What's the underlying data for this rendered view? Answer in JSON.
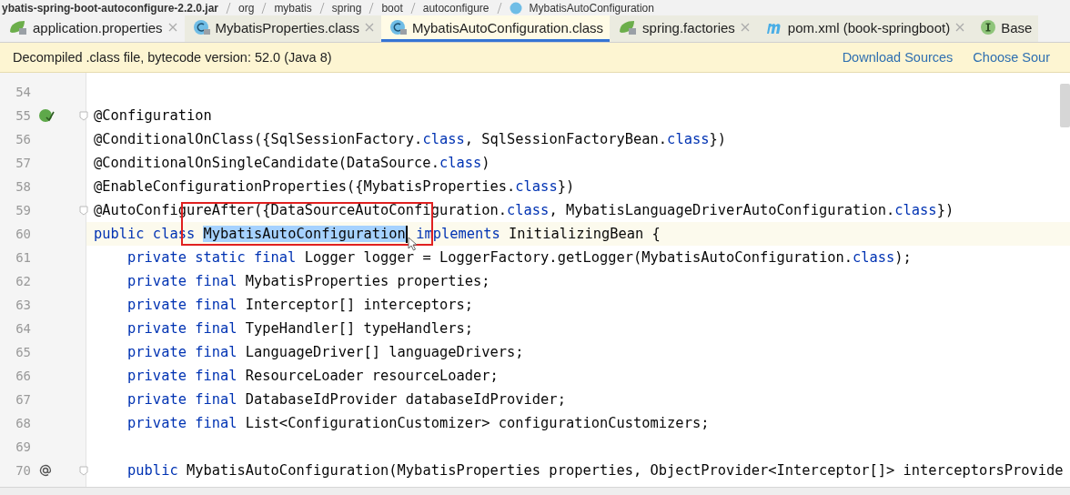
{
  "breadcrumb": [
    {
      "label": "ybatis-spring-boot-autoconfigure-2.2.0.jar",
      "kind": "jar"
    },
    {
      "label": "org",
      "kind": "folder"
    },
    {
      "label": "mybatis",
      "kind": "folder"
    },
    {
      "label": "spring",
      "kind": "folder"
    },
    {
      "label": "boot",
      "kind": "folder"
    },
    {
      "label": "autoconfigure",
      "kind": "folder"
    },
    {
      "label": "MybatisAutoConfiguration",
      "kind": "class"
    }
  ],
  "tabs": [
    {
      "label": "application.properties",
      "kind": "spring",
      "selected": false,
      "closable": true
    },
    {
      "label": "MybatisProperties.class",
      "kind": "class",
      "selected": false,
      "closable": true
    },
    {
      "label": "MybatisAutoConfiguration.class",
      "kind": "class",
      "selected": true,
      "closable": false
    },
    {
      "label": "spring.factories",
      "kind": "spring",
      "selected": false,
      "closable": true
    },
    {
      "label": "pom.xml (book-springboot)",
      "kind": "maven",
      "selected": false,
      "closable": true
    },
    {
      "label": "Base",
      "kind": "interface",
      "selected": false,
      "closable": false
    }
  ],
  "banner": {
    "message": "Decompiled .class file, bytecode version: 52.0 (Java 8)",
    "links": [
      "Download Sources",
      "Choose Sour"
    ]
  },
  "lines": [
    {
      "number": "54"
    },
    {
      "number": "55",
      "kind": "bean",
      "fold": true,
      "tokens": [
        {
          "text": "@Configuration",
          "kind": "plain"
        }
      ]
    },
    {
      "number": "56",
      "tokens": [
        {
          "text": "@ConditionalOnClass({SqlSessionFactory.",
          "kind": "plain"
        },
        {
          "text": "class",
          "kind": "kw"
        },
        {
          "text": ", SqlSessionFactoryBean.",
          "kind": "plain"
        },
        {
          "text": "class",
          "kind": "kw"
        },
        {
          "text": "})",
          "kind": "plain"
        }
      ]
    },
    {
      "number": "57",
      "tokens": [
        {
          "text": "@ConditionalOnSingleCandidate(DataSource.",
          "kind": "plain"
        },
        {
          "text": "class",
          "kind": "kw"
        },
        {
          "text": ")",
          "kind": "plain"
        }
      ]
    },
    {
      "number": "58",
      "tokens": [
        {
          "text": "@EnableConfigurationProperties({MybatisProperties.",
          "kind": "plain"
        },
        {
          "text": "class",
          "kind": "kw"
        },
        {
          "text": "})",
          "kind": "plain"
        }
      ]
    },
    {
      "number": "59",
      "fold": true,
      "tokens": [
        {
          "text": "@AutoConfigureAfter({DataSourceAutoConfiguration.",
          "kind": "plain"
        },
        {
          "text": "class",
          "kind": "kw"
        },
        {
          "text": ", MybatisLanguageDriverAutoConfiguration.",
          "kind": "plain"
        },
        {
          "text": "class",
          "kind": "kw"
        },
        {
          "text": "})",
          "kind": "plain"
        }
      ]
    },
    {
      "number": "60",
      "current": true,
      "tokens": [
        {
          "text": "public class ",
          "kind": "kw"
        },
        {
          "text": "MybatisAutoConfiguration",
          "kind": "selected"
        },
        {
          "text": " implements ",
          "kind": "kw"
        },
        {
          "text": "InitializingBean {",
          "kind": "plain"
        }
      ]
    },
    {
      "number": "61",
      "tokens": [
        {
          "text": "    private static final ",
          "kind": "kw"
        },
        {
          "text": "Logger logger = LoggerFactory.getLogger(MybatisAutoConfiguration.",
          "kind": "plain"
        },
        {
          "text": "class",
          "kind": "kw"
        },
        {
          "text": ");",
          "kind": "plain"
        }
      ]
    },
    {
      "number": "62",
      "tokens": [
        {
          "text": "    private final ",
          "kind": "kw"
        },
        {
          "text": "MybatisProperties properties;",
          "kind": "plain"
        }
      ]
    },
    {
      "number": "63",
      "tokens": [
        {
          "text": "    private final ",
          "kind": "kw"
        },
        {
          "text": "Interceptor[] interceptors;",
          "kind": "plain"
        }
      ]
    },
    {
      "number": "64",
      "tokens": [
        {
          "text": "    private final ",
          "kind": "kw"
        },
        {
          "text": "TypeHandler[] typeHandlers;",
          "kind": "plain"
        }
      ]
    },
    {
      "number": "65",
      "tokens": [
        {
          "text": "    private final ",
          "kind": "kw"
        },
        {
          "text": "LanguageDriver[] languageDrivers;",
          "kind": "plain"
        }
      ]
    },
    {
      "number": "66",
      "tokens": [
        {
          "text": "    private final ",
          "kind": "kw"
        },
        {
          "text": "ResourceLoader resourceLoader;",
          "kind": "plain"
        }
      ]
    },
    {
      "number": "67",
      "tokens": [
        {
          "text": "    private final ",
          "kind": "kw"
        },
        {
          "text": "DatabaseIdProvider databaseIdProvider;",
          "kind": "plain"
        }
      ]
    },
    {
      "number": "68",
      "tokens": [
        {
          "text": "    private final ",
          "kind": "kw"
        },
        {
          "text": "List<ConfigurationCustomizer> configurationCustomizers;",
          "kind": "plain"
        }
      ]
    },
    {
      "number": "69"
    },
    {
      "number": "70",
      "kind": "at",
      "fold": true,
      "tokens": [
        {
          "text": "    public ",
          "kind": "kw"
        },
        {
          "text": "MybatisAutoConfiguration(MybatisProperties properties, ObjectProvider<Interceptor[]> interceptorsProvide",
          "kind": "plain"
        }
      ]
    }
  ]
}
